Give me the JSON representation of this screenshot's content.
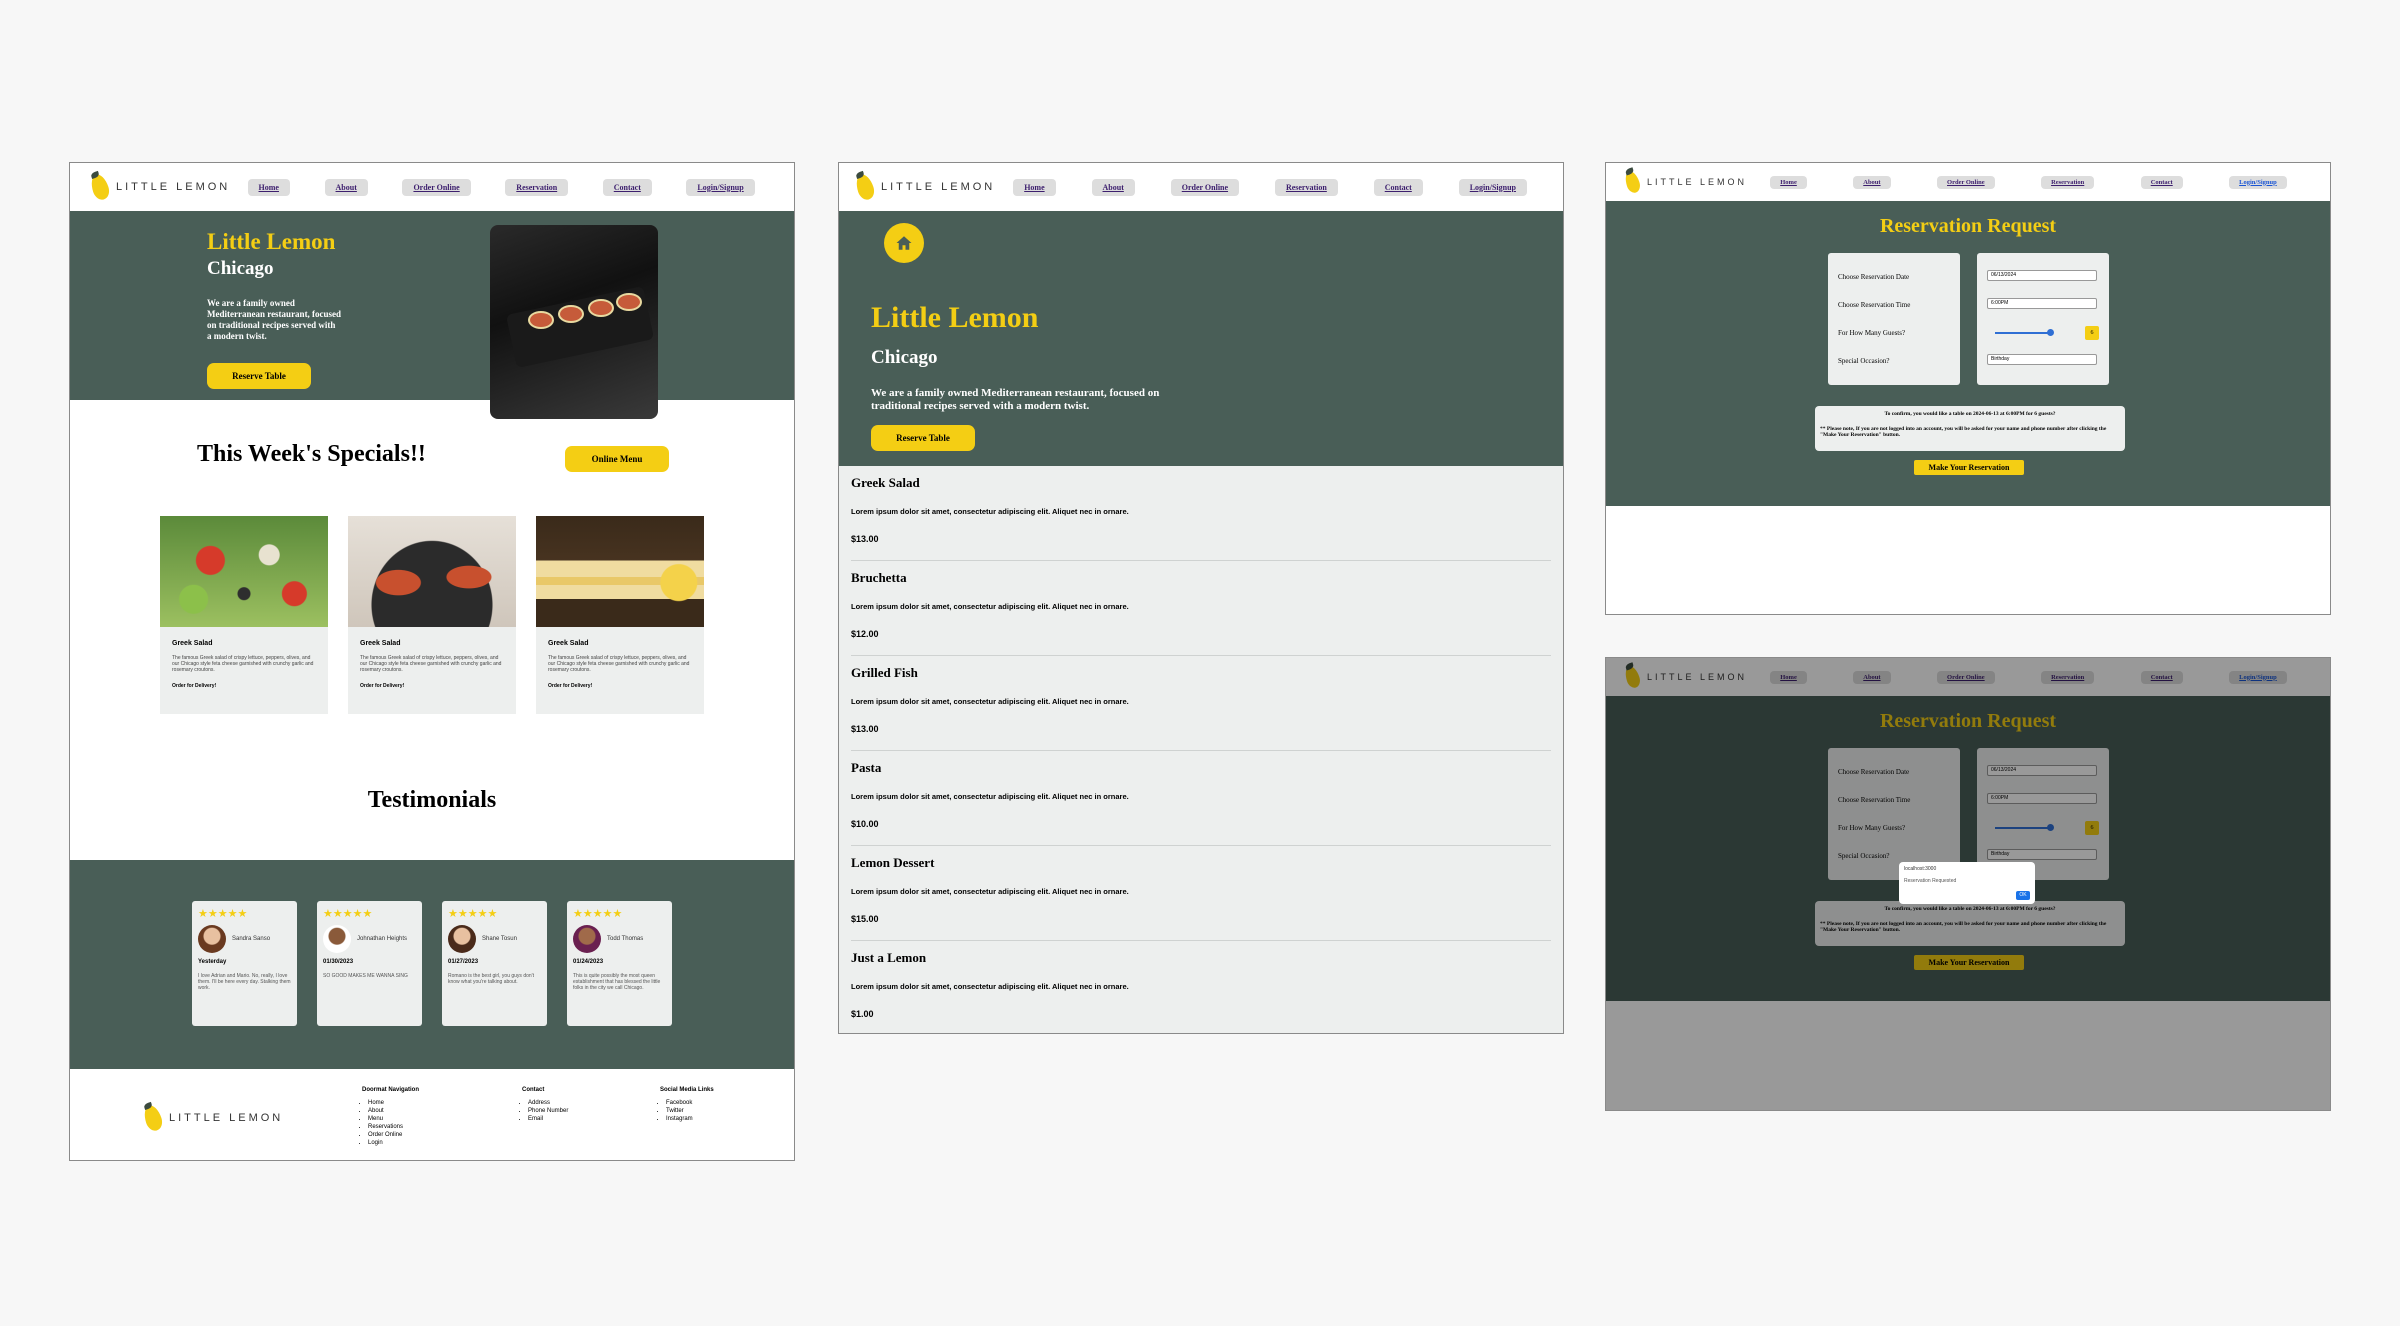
{
  "brand": {
    "name": "LITTLE LEMON"
  },
  "nav": {
    "links": [
      "Home",
      "About",
      "Order Online",
      "Reservation",
      "Contact",
      "Login/Signup"
    ]
  },
  "home_page": {
    "hero": {
      "title": "Little Lemon",
      "subtitle": "Chicago",
      "description": "We are a family owned Mediterranean restaurant, focused on traditional recipes served with a modern twist.",
      "button": "Reserve Table"
    },
    "specials": {
      "title": "This Week's Specials!!",
      "button": "Online Menu",
      "cards": [
        {
          "name": "Greek Salad",
          "text": "The famous Greek salad of crispy lettuce, peppers, olives, and our Chicago style feta cheese garnished with crunchy garlic and rosemary croutons.",
          "cta": "Order for Delivery!"
        },
        {
          "name": "Greek Salad",
          "text": "The famous Greek salad of crispy lettuce, peppers, olives, and our Chicago style feta cheese garnished with crunchy garlic and rosemary croutons.",
          "cta": "Order for Delivery!"
        },
        {
          "name": "Greek Salad",
          "text": "The famous Greek salad of crispy lettuce, peppers, olives, and our Chicago style feta cheese garnished with crunchy garlic and rosemary croutons.",
          "cta": "Order for Delivery!"
        }
      ]
    },
    "testimonials": {
      "title": "Testimonials",
      "items": [
        {
          "stars": "★★★★★",
          "name": "Sandra Sanso",
          "date": "Yesterday",
          "text": "I love Adrian and Mario. No, really, I love them. I'll be here every day. Stalking them work."
        },
        {
          "stars": "★★★★★",
          "name": "Johnathan Heights",
          "date": "01/30/2023",
          "text": "SO GOOD MAKES ME WANNA SING"
        },
        {
          "stars": "★★★★★",
          "name": "Shane Tosun",
          "date": "01/27/2023",
          "text": "Romano is the best girl, you guys don't know what you're talking about."
        },
        {
          "stars": "★★★★★",
          "name": "Todd Thomas",
          "date": "01/24/2023",
          "text": "This is quite possibly the most queen establishment that has blessed the little folks in the city we call Chicago."
        }
      ]
    },
    "footer": {
      "columns": [
        {
          "title": "Doormat Navigation",
          "items": [
            "Home",
            "About",
            "Menu",
            "Reservations",
            "Order Online",
            "Login"
          ]
        },
        {
          "title": "Contact",
          "items": [
            "Address",
            "Phone Number",
            "Email"
          ]
        },
        {
          "title": "Social Media Links",
          "items": [
            "Facebook",
            "Twitter",
            "Instagram"
          ]
        }
      ]
    }
  },
  "menu_page": {
    "hero": {
      "title": "Little Lemon",
      "subtitle": "Chicago",
      "description": "We are a family owned Mediterranean restaurant, focused on traditional recipes served with a modern twist.",
      "button": "Reserve Table"
    },
    "items": [
      {
        "name": "Greek Salad",
        "desc": "Lorem ipsum dolor sit amet, consectetur adipiscing elit. Aliquet nec in ornare.",
        "price": "$13.00"
      },
      {
        "name": "Bruchetta",
        "desc": "Lorem ipsum dolor sit amet, consectetur adipiscing elit. Aliquet nec in ornare.",
        "price": "$12.00"
      },
      {
        "name": "Grilled Fish",
        "desc": "Lorem ipsum dolor sit amet, consectetur adipiscing elit. Aliquet nec in ornare.",
        "price": "$13.00"
      },
      {
        "name": "Pasta",
        "desc": "Lorem ipsum dolor sit amet, consectetur adipiscing elit. Aliquet nec in ornare.",
        "price": "$10.00"
      },
      {
        "name": "Lemon Dessert",
        "desc": "Lorem ipsum dolor sit amet, consectetur adipiscing elit. Aliquet nec in ornare.",
        "price": "$15.00"
      },
      {
        "name": "Just a Lemon",
        "desc": "Lorem ipsum dolor sit amet, consectetur adipiscing elit. Aliquet nec in ornare.",
        "price": "$1.00"
      }
    ]
  },
  "reservation_page": {
    "title": "Reservation Request",
    "labels": [
      "Choose Reservation Date",
      "Choose Reservation Time",
      "For How Many Guests?",
      "Special Occasion?"
    ],
    "date_value": "06/13/2024",
    "time_value": "6:00PM",
    "guests_value": "6",
    "occasion_value": "Birthday",
    "confirm_text": "To confirm, you would like a table on 2024-06-13 at 6:00PM for 6 guests?",
    "note_text": "** Please note, If you are not logged into an account, you will be asked for your name and phone number after clicking the \"Make Your Reservation\" button.",
    "button": "Make Your Reservation"
  },
  "dialog": {
    "header": "localhost:3000",
    "message": "Reservation Requested",
    "ok": "OK"
  },
  "colors": {
    "green": "#495e57",
    "yellow": "#f4ce14",
    "light": "#edefee"
  }
}
